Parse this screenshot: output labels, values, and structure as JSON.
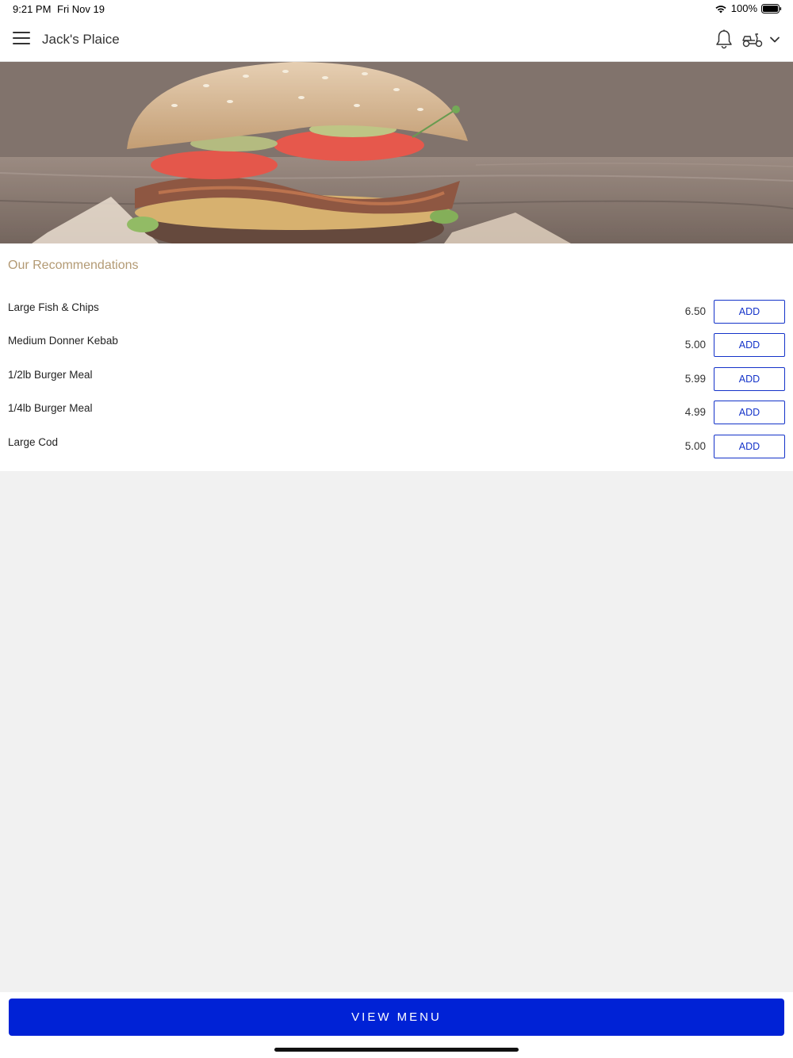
{
  "status_bar": {
    "time": "9:21 PM",
    "date": "Fri Nov 19",
    "battery": "100%"
  },
  "header": {
    "store_name": "Jack's Plaice",
    "icons": [
      "menu-icon",
      "bell-icon",
      "scooter-icon",
      "chevron-down-icon"
    ]
  },
  "hero": {
    "image": "burger-photo"
  },
  "recommendations": {
    "title": "Our Recommendations",
    "items": [
      {
        "name": "Large Fish & Chips",
        "price": "6.50",
        "button": "ADD"
      },
      {
        "name": "Medium Donner Kebab",
        "price": "5.00",
        "button": "ADD"
      },
      {
        "name": "1/2lb Burger Meal",
        "price": "5.99",
        "button": "ADD"
      },
      {
        "name": "1/4lb Burger Meal",
        "price": "4.99",
        "button": "ADD"
      },
      {
        "name": "Large Cod",
        "price": "5.00",
        "button": "ADD"
      }
    ]
  },
  "footer": {
    "view_menu_label": "VIEW MENU"
  },
  "colors": {
    "accent": "#0022d6",
    "add_button": "#1433c9",
    "section_title": "#b39a74",
    "background": "#f1f1f1"
  }
}
